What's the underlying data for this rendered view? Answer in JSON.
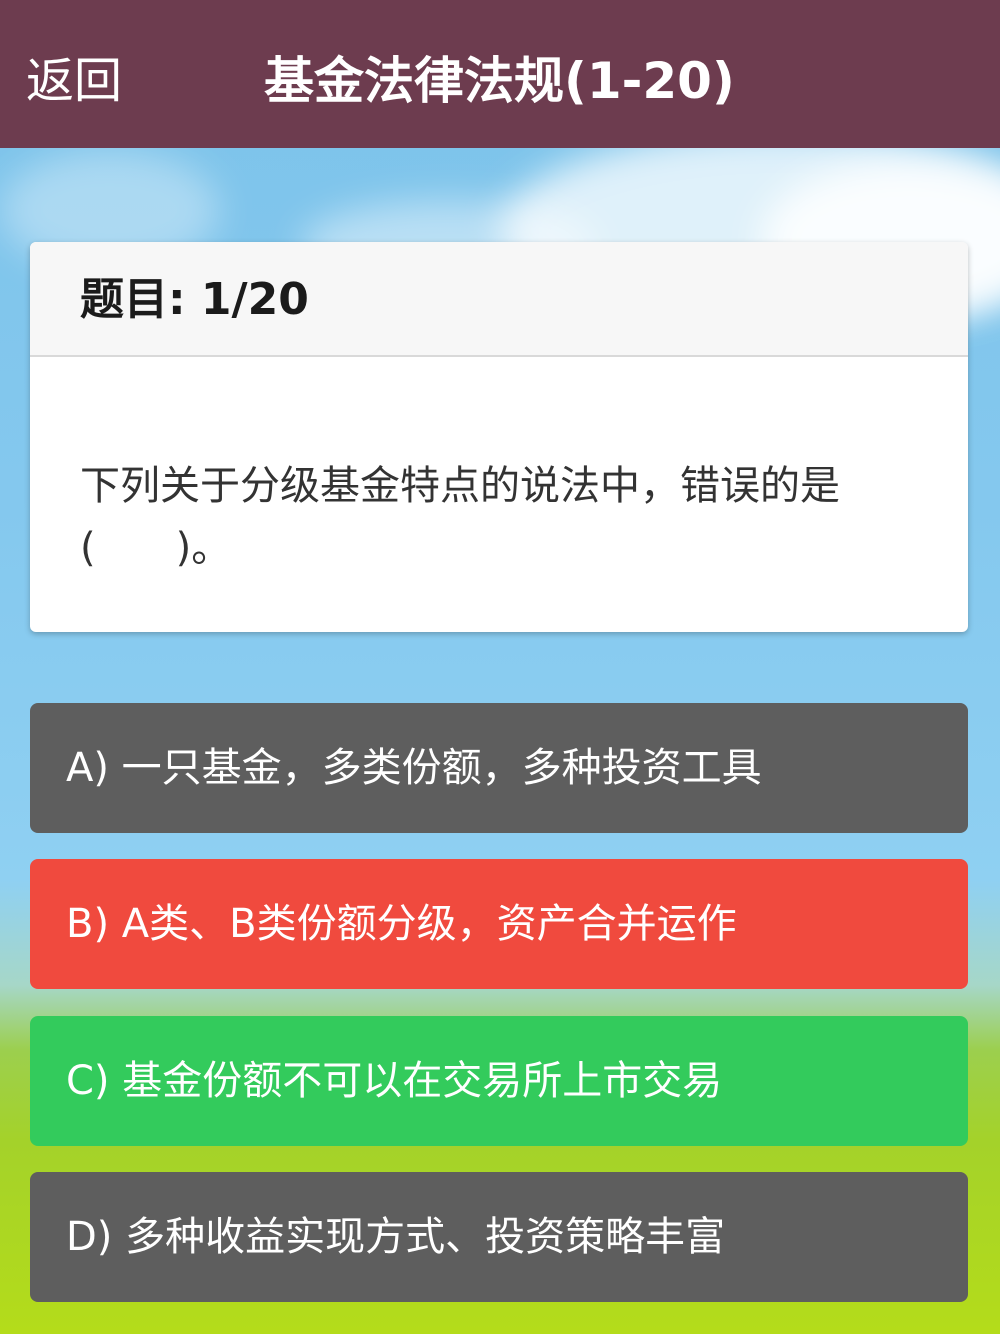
{
  "header": {
    "back_label": "返回",
    "title": "基金法律法规(1-20)"
  },
  "question": {
    "label": "题目: 1/20",
    "text": "下列关于分级基金特点的说法中，错误的是(　　)。"
  },
  "options": [
    {
      "label": "A) 一只基金，多类份额，多种投资工具",
      "state": "default",
      "color": "#5e5e5e"
    },
    {
      "label": "B) A类、B类份额分级，资产合并运作",
      "state": "wrong",
      "color": "#f04a3e"
    },
    {
      "label": "C) 基金份额不可以在交易所上市交易",
      "state": "correct",
      "color": "#33cb5c"
    },
    {
      "label": "D) 多种收益实现方式、投资策略丰富",
      "state": "default",
      "color": "#5e5e5e"
    }
  ],
  "colors": {
    "header_bg": "#6d3c4f"
  }
}
